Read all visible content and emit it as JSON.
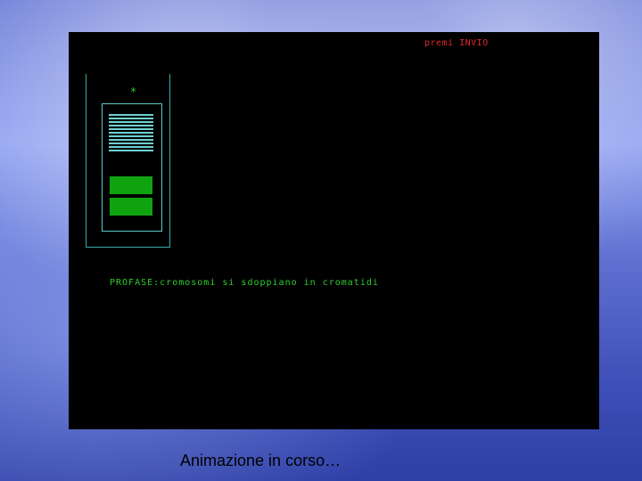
{
  "screen": {
    "prompt": "premi INVIO",
    "marker": "*",
    "phase_text": "PROFASE:cromosomi si sdoppiano in cromatidi"
  },
  "caption": "Animazione in corso…",
  "colors": {
    "screen_bg": "#000000",
    "prompt": "#e0282a",
    "phase_text": "#2ccf2c",
    "frame": "#5fc7c7",
    "chromatid_block": "#0fa40f"
  }
}
